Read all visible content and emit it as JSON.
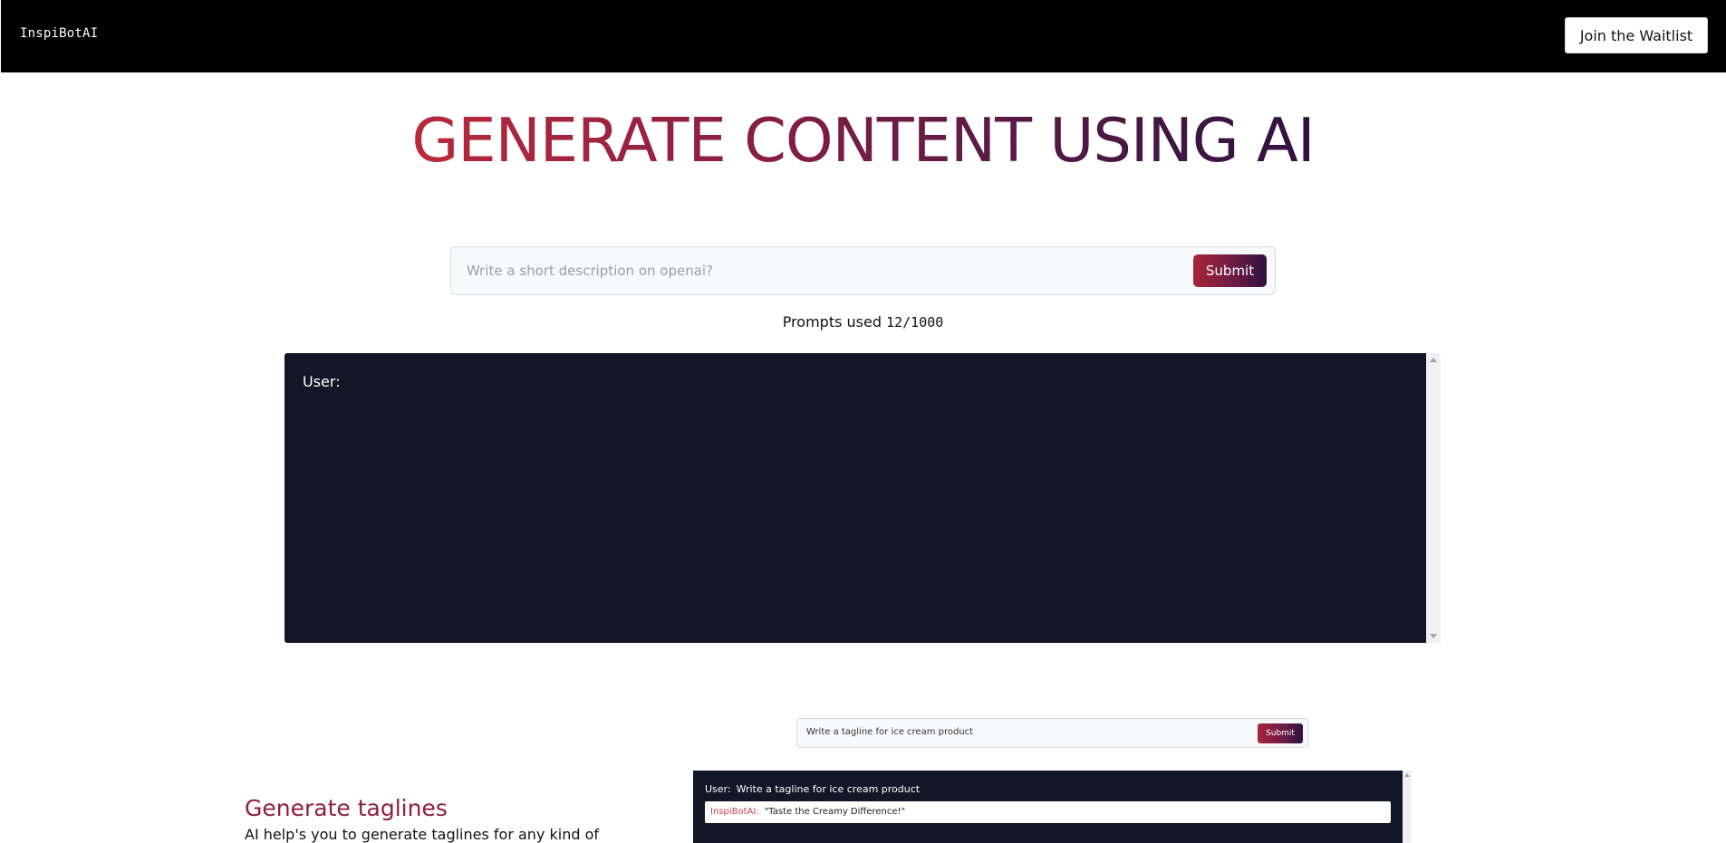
{
  "header": {
    "brand": "InspiBotAI",
    "waitlist_label": "Join the Waitlist"
  },
  "hero": {
    "title": "GENERATE CONTENT USING AI"
  },
  "prompt": {
    "placeholder": "Write a short description on openai?",
    "value": "",
    "submit_label": "Submit"
  },
  "usage": {
    "label": "Prompts used",
    "count": "12/1000"
  },
  "chat": {
    "user_label": "User:"
  },
  "feature": {
    "title": "Generate taglines",
    "description": "AI help's you to generate taglines for any kind of"
  },
  "preview": {
    "prompt_text": "Write a tagline for ice cream product",
    "submit_label": "Submit",
    "user_label": "User:",
    "user_message": "Write a tagline for ice cream product",
    "bot_label": "InspiBotAI:",
    "bot_reply": "\"Taste the Creamy Difference!\""
  },
  "colors": {
    "header_bg": "#000000",
    "chat_bg": "#121728",
    "accent_start": "#b82a3a",
    "accent_end": "#2e1240",
    "feature_title": "#8f1f3b"
  }
}
